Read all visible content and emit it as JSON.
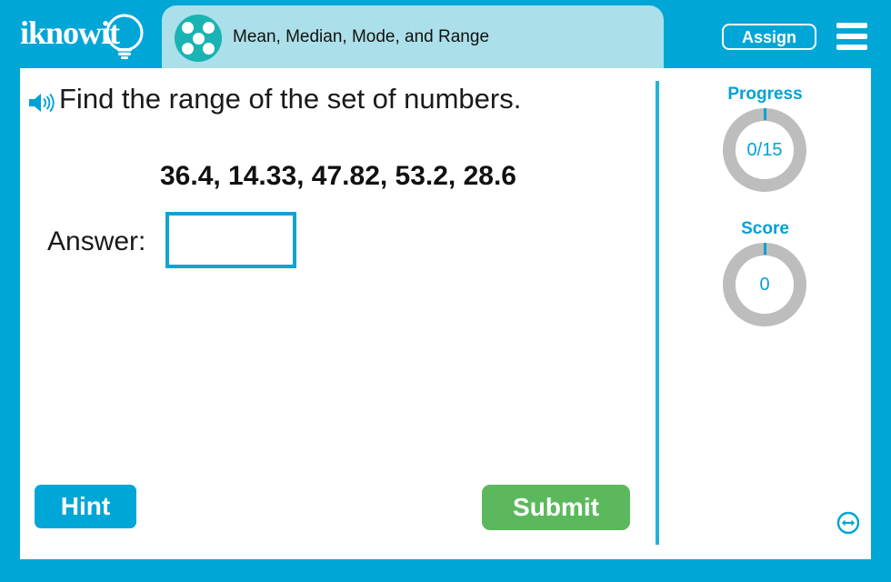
{
  "header": {
    "logo_text": "iknowit",
    "logo_icon": "lightbulb-icon",
    "subject_icon": "five-dots-circle-icon",
    "title": "Mean, Median, Mode, and Range",
    "assign_label": "Assign",
    "menu_icon": "hamburger-menu-icon",
    "bar_color": "#00a6d6",
    "pill_color": "#abe0ea",
    "subject_icon_color": "#19b3b3"
  },
  "question": {
    "audio_icon": "speaker-icon",
    "prompt": "Find the range of the set of numbers.",
    "numbers": "36.4, 14.33, 47.82, 53.2, 28.6",
    "answer_label": "Answer:",
    "answer_value": "",
    "answer_placeholder": "",
    "input_border_color": "#14a2d2"
  },
  "actions": {
    "hint_label": "Hint",
    "hint_color": "#00a6d6",
    "submit_label": "Submit",
    "submit_color": "#5cb85c"
  },
  "rail": {
    "progress": {
      "title": "Progress",
      "value": "0/15",
      "ring_color": "#bdbdbd",
      "accent_color": "#00a2d6"
    },
    "score": {
      "title": "Score",
      "value": "0",
      "ring_color": "#bdbdbd",
      "accent_color": "#00a2d6"
    },
    "resize_icon": "resize-horizontal-icon"
  }
}
